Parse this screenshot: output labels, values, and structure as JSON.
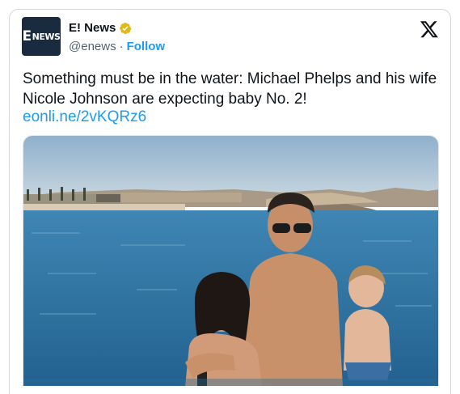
{
  "account": {
    "name": "E! News",
    "handle": "@enews",
    "separator": "·",
    "follow_label": "Follow",
    "avatar_text_e": "E",
    "avatar_text_news": "NEWS"
  },
  "tweet": {
    "text": "Something must be in the water: Michael Phelps and his wife Nicole Johnson are expecting baby No. 2!",
    "link": "eonli.ne/2vKQRz6"
  },
  "icons": {
    "verified": "verified-badge-icon",
    "platform": "x-logo-icon"
  },
  "colors": {
    "link": "#1d9bf0",
    "verified_gold": "#e2b719",
    "text": "#0f1419",
    "secondary": "#536471"
  }
}
